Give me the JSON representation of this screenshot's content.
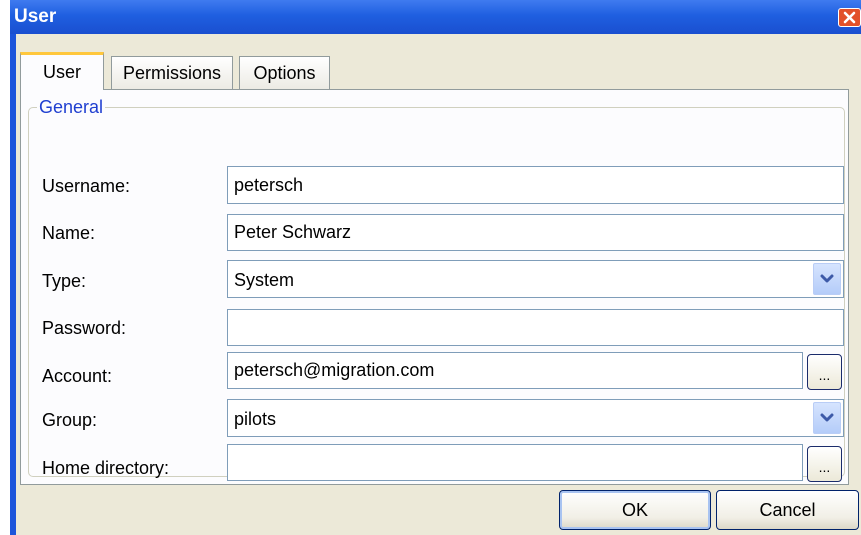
{
  "window": {
    "title": "User"
  },
  "tabs": [
    {
      "label": "User",
      "active": true
    },
    {
      "label": "Permissions",
      "active": false
    },
    {
      "label": "Options",
      "active": false
    }
  ],
  "group": {
    "title": "General"
  },
  "fields": {
    "username": {
      "label": "Username:",
      "value": "petersch"
    },
    "name": {
      "label": "Name:",
      "value": "Peter Schwarz"
    },
    "type": {
      "label": "Type:",
      "value": "System"
    },
    "password": {
      "label": "Password:",
      "value": ""
    },
    "account": {
      "label": "Account:",
      "value": "petersch@migration.com",
      "browse_label": "..."
    },
    "group": {
      "label": "Group:",
      "value": "pilots"
    },
    "home_directory": {
      "label": "Home directory:",
      "value": "",
      "browse_label": "..."
    }
  },
  "buttons": {
    "ok": "OK",
    "cancel": "Cancel"
  },
  "colors": {
    "titlebar": "#1f5fe0",
    "dialog_bg": "#ece9d8",
    "group_title": "#1f3fd0",
    "tab_highlight": "#ffc73c",
    "close_button": "#e2512a"
  },
  "icons": {
    "close": "close-icon",
    "dropdown": "chevron-down-icon"
  }
}
